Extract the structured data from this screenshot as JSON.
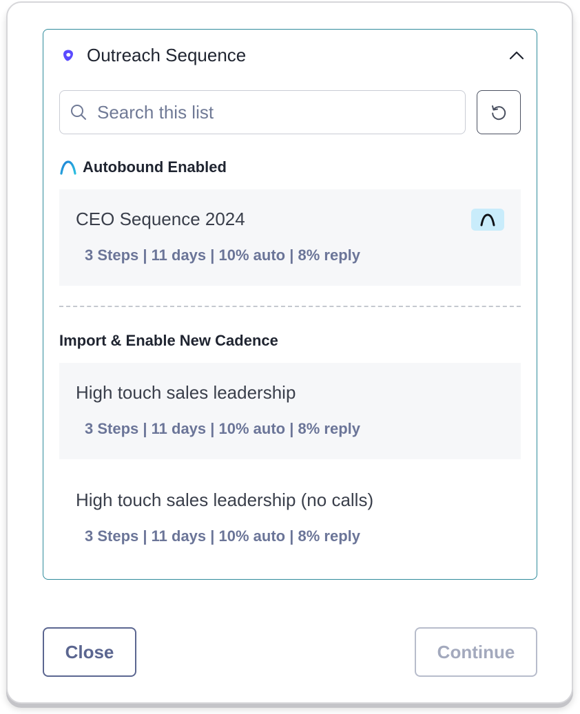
{
  "panel": {
    "title": "Outreach Sequence"
  },
  "search": {
    "placeholder": "Search this list"
  },
  "sections": {
    "enabled_label": "Autobound Enabled",
    "import_label": "Import & Enable New Cadence"
  },
  "items": [
    {
      "title": "CEO Sequence 2024",
      "meta": "3 Steps | 11 days | 10% auto | 8% reply"
    },
    {
      "title": "High touch sales leadership",
      "meta": "3 Steps | 11 days | 10% auto | 8% reply"
    },
    {
      "title": "High touch sales leadership (no calls)",
      "meta": "3 Steps | 11 days | 10% auto | 8% reply"
    }
  ],
  "footer": {
    "close_label": "Close",
    "continue_label": "Continue"
  },
  "colors": {
    "panel_border": "#2e8a9b",
    "outreach_brand": "#5b4bff",
    "autobound_brand": "#1aa3d9",
    "badge_bg": "#c9ecfb",
    "meta_text": "#6b7598"
  },
  "icons": {
    "header": "outreach-logo-icon",
    "collapse": "chevron-up-icon",
    "search": "search-icon",
    "refresh": "refresh-icon",
    "section": "autobound-logo-icon",
    "badge": "autobound-badge-icon"
  }
}
